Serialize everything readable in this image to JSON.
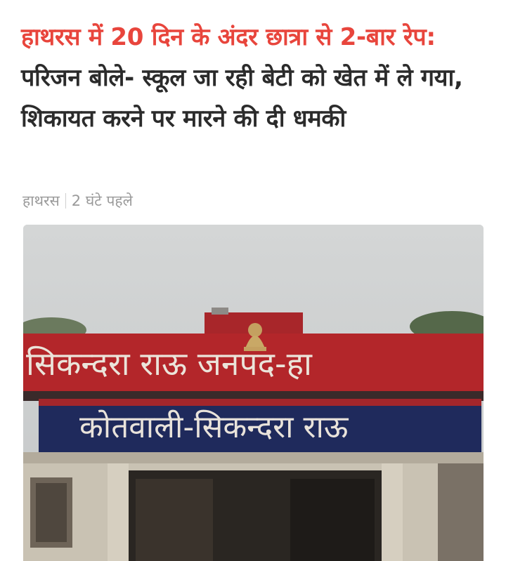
{
  "article": {
    "headline_highlight": "हाथरस में 20 दिन के अंदर छात्रा से 2-बार रेप:",
    "headline_rest": " परिजन बोले- स्कूल जा रही बेटी को खेत में ले गया, शिकायत करने पर मारने की दी धमकी",
    "location": "हाथरस",
    "time_ago": "2 घंटे पहले"
  },
  "photo": {
    "sign_top": "सिकन्दरा राऊ जनपद-हा",
    "sign_bottom": "कोतवाली-सिकन्दरा राऊ"
  },
  "colors": {
    "highlight": "#e8453c",
    "text": "#2b2b2b",
    "meta": "#9a9a9a",
    "sign_red": "#b3262a",
    "sign_blue": "#1f2a5c"
  }
}
